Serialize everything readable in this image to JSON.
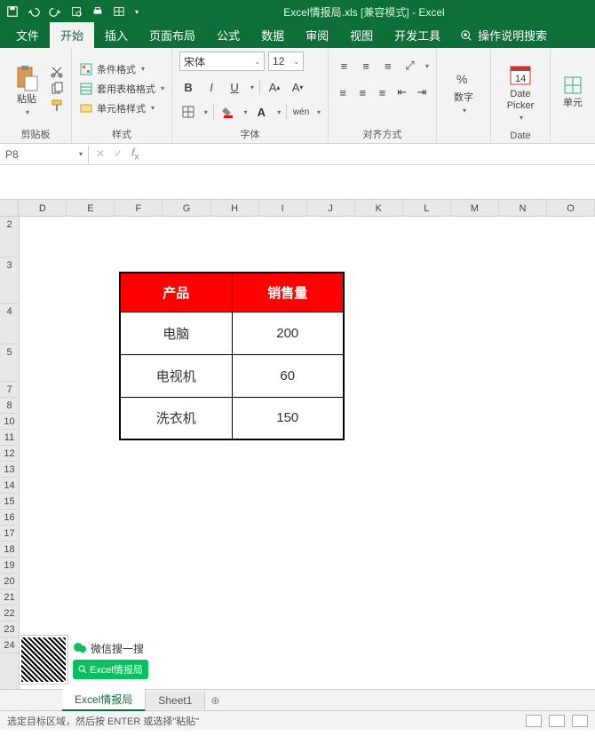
{
  "title": {
    "file": "Excel情报局.xls",
    "compat": "[兼容模式]",
    "app": "Excel"
  },
  "menu": {
    "file": "文件",
    "home": "开始",
    "insert": "插入",
    "layout": "页面布局",
    "formula": "公式",
    "data": "数据",
    "review": "审阅",
    "view": "视图",
    "dev": "开发工具",
    "search": "操作说明搜索"
  },
  "ribbon": {
    "clipboard": {
      "paste": "粘贴",
      "label": "剪贴板"
    },
    "styles": {
      "cond": "条件格式",
      "table": "套用表格格式",
      "cell": "单元格样式",
      "label": "样式"
    },
    "font": {
      "name": "宋体",
      "size": "12",
      "label": "字体"
    },
    "align": {
      "label": "对齐方式"
    },
    "number": {
      "btn": "数字",
      "label": ""
    },
    "date": {
      "btn": "Date Picker",
      "label": "Date"
    },
    "cells": {
      "btn": "单元"
    }
  },
  "namebox": "P8",
  "cols": [
    "D",
    "E",
    "F",
    "G",
    "H",
    "I",
    "J",
    "K",
    "L",
    "M",
    "N",
    "O"
  ],
  "rownums": [
    "2",
    "3",
    "4",
    "5",
    "7",
    "8",
    "10",
    "11",
    "12",
    "13",
    "14",
    "15",
    "16",
    "17",
    "18",
    "19",
    "20",
    "21",
    "22",
    "23",
    "24"
  ],
  "table": {
    "headers": [
      "产品",
      "销售量"
    ],
    "rows": [
      [
        "电脑",
        "200"
      ],
      [
        "电视机",
        "60"
      ],
      [
        "洗衣机",
        "150"
      ]
    ]
  },
  "wx": {
    "search": "微信搜一搜",
    "badge": "Excel情报局"
  },
  "sheets": {
    "s1": "Excel情报局",
    "s2": "Sheet1"
  },
  "status": "选定目标区域，然后按 ENTER 或选择\"粘贴\""
}
